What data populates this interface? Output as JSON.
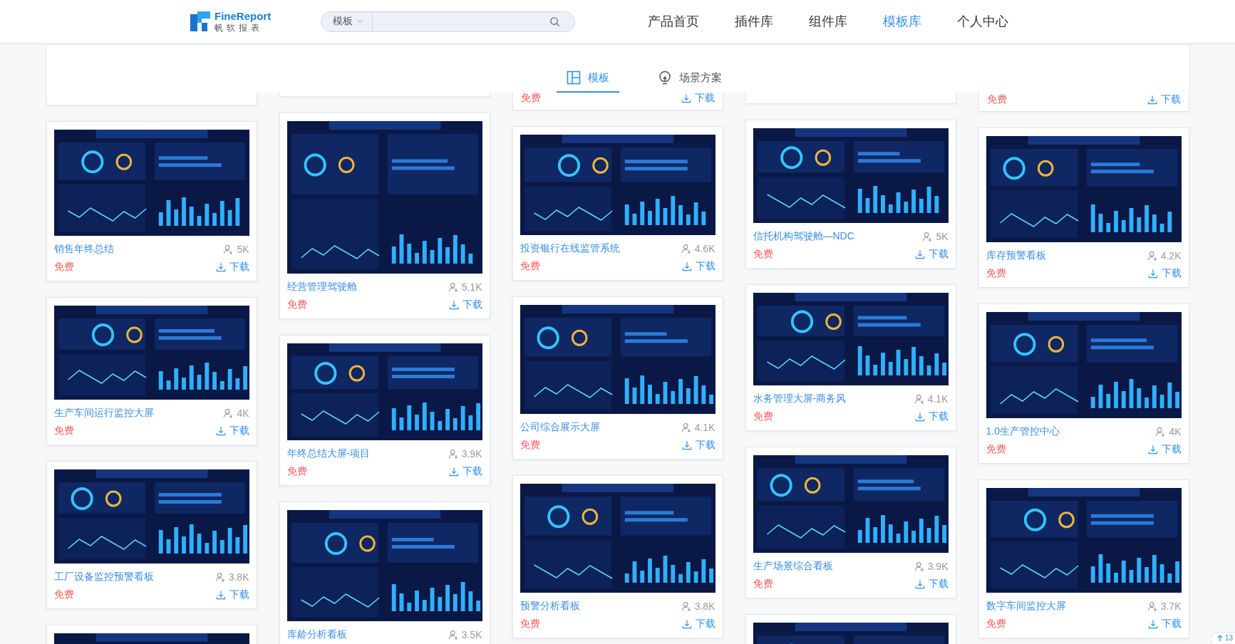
{
  "header": {
    "logo": {
      "name": "FineReport",
      "subtitle": "帆软报表"
    },
    "search": {
      "scope": "模板"
    },
    "nav": [
      {
        "label": "产品首页",
        "selected": false
      },
      {
        "label": "插件库",
        "selected": false
      },
      {
        "label": "组件库",
        "selected": false
      },
      {
        "label": "模板库",
        "selected": true
      },
      {
        "label": "个人中心",
        "selected": false
      }
    ]
  },
  "tabs": [
    {
      "label": "模板",
      "kind": "grid",
      "selected": true
    },
    {
      "label": "场景方案",
      "kind": "bulb",
      "selected": false
    }
  ],
  "columns": [
    {
      "cards": [
        {
          "image": {
            "kind": "picture"
          },
          "title": "销售年终总结",
          "views": "5K",
          "price": "免费",
          "download": "下载"
        },
        {
          "image": {
            "kind": "picture"
          },
          "title": "生产车间运行监控大屏",
          "views": "4K",
          "price": "免费",
          "download": "下载"
        },
        {
          "image": {
            "kind": "picture"
          },
          "title": "工厂设备监控预警看板",
          "views": "3.8K",
          "price": "免费",
          "download": "下载"
        },
        {
          "image": {
            "kind": "picture"
          }
        }
      ]
    },
    {
      "cards": [
        {
          "image": {
            "kind": "picture"
          },
          "title": "经营管理驾驶舱",
          "views": "5.1K",
          "price": "免费",
          "download": "下载"
        },
        {
          "image": {
            "kind": "picture"
          },
          "title": "年终总结大屏-项目",
          "views": "3.9K",
          "price": "免费",
          "download": "下载"
        },
        {
          "image": {
            "kind": "picture"
          },
          "title": "库龄分析看板",
          "views": "3.5K"
        }
      ]
    },
    {
      "top_card": {
        "price": "免费",
        "download": "下载"
      },
      "cards": [
        {
          "image": {
            "kind": "picture"
          },
          "title": "投资银行在线监管系统",
          "views": "4.6K",
          "price": "免费",
          "download": "下载"
        },
        {
          "image": {
            "kind": "picture"
          },
          "title": "公司综合展示大屏",
          "views": "4.1K",
          "price": "免费",
          "download": "下载"
        },
        {
          "image": {
            "kind": "picture"
          },
          "title": "预警分析看板",
          "views": "3.8K",
          "price": "免费",
          "download": "下载"
        }
      ]
    },
    {
      "cards": [
        {
          "image": {
            "kind": "picture"
          },
          "title": "信托机构驾驶舱—NDC",
          "views": "5K",
          "price": "免费",
          "download": "下载"
        },
        {
          "image": {
            "kind": "picture"
          },
          "title": "水务管理大屏-商务风",
          "views": "4.1K",
          "price": "免费",
          "download": "下载"
        },
        {
          "image": {
            "kind": "picture"
          },
          "title": "生产场景综合看板",
          "views": "3.9K",
          "price": "免费",
          "download": "下载"
        },
        {
          "image": {
            "kind": "picture"
          }
        }
      ]
    },
    {
      "top_card": {
        "price": "免费",
        "download": "下载"
      },
      "cards": [
        {
          "image": {
            "kind": "picture"
          },
          "title": "库存预警看板",
          "views": "4.2K",
          "price": "免费",
          "download": "下载"
        },
        {
          "image": {
            "kind": "picture"
          },
          "title": "1.0生产管控中心",
          "views": "4K",
          "price": "免费",
          "download": "下载"
        },
        {
          "image": {
            "kind": "picture"
          },
          "title": "数字车间监控大屏",
          "views": "3.7K",
          "price": "免费",
          "download": "下载"
        }
      ]
    }
  ],
  "scroll_badge": "13"
}
